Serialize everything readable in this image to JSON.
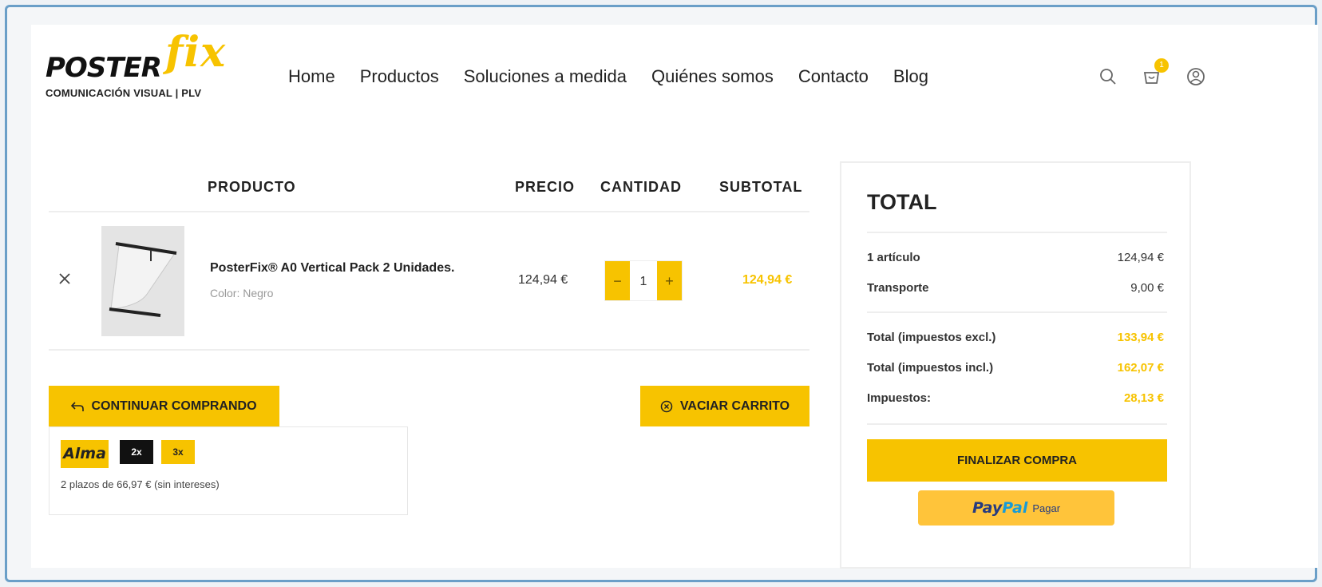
{
  "header": {
    "logo_main": "POSTER",
    "logo_accent": "fix",
    "logo_tagline": "COMUNICACIÓN VISUAL | PLV",
    "nav": [
      "Home",
      "Productos",
      "Soluciones a medida",
      "Quiénes somos",
      "Contacto",
      "Blog"
    ],
    "icons": [
      "search-icon",
      "cart-icon",
      "user-icon"
    ],
    "cart_count": "1"
  },
  "cart": {
    "columns": {
      "product": "PRODUCTO",
      "price": "PRECIO",
      "quantity": "CANTIDAD",
      "subtotal": "SUBTOTAL"
    },
    "items": [
      {
        "name": "PosterFix® A0 Vertical Pack 2 Unidades.",
        "attribute": "Color: Negro",
        "price": "124,94 €",
        "quantity": "1",
        "subtotal": "124,94 €"
      }
    ],
    "qty_minus": "−",
    "qty_plus": "+",
    "continue_label": "CONTINUAR COMPRANDO",
    "empty_label": "VACIAR CARRITO"
  },
  "alma": {
    "logo": "Alma",
    "options": [
      "2x",
      "3x"
    ],
    "selected": "2x",
    "text": "2 plazos de 66,97 € (sin intereses)"
  },
  "totals": {
    "title": "TOTAL",
    "rows1": [
      {
        "label": "1 artículo",
        "value": "124,94 €"
      },
      {
        "label": "Transporte",
        "value": "9,00 €"
      }
    ],
    "rows2": [
      {
        "label": "Total (impuestos excl.)",
        "value": "133,94 €"
      },
      {
        "label": "Total (impuestos incl.)",
        "value": "162,07 €"
      },
      {
        "label": "Impuestos:",
        "value": "28,13 €"
      }
    ],
    "checkout_label": "FINALIZAR COMPRA",
    "paypal_logo_a": "Pay",
    "paypal_logo_b": "Pal",
    "paypal_label": "Pagar"
  },
  "colors": {
    "accent": "#f7c300",
    "text": "#222222",
    "border": "#eeeeee"
  }
}
